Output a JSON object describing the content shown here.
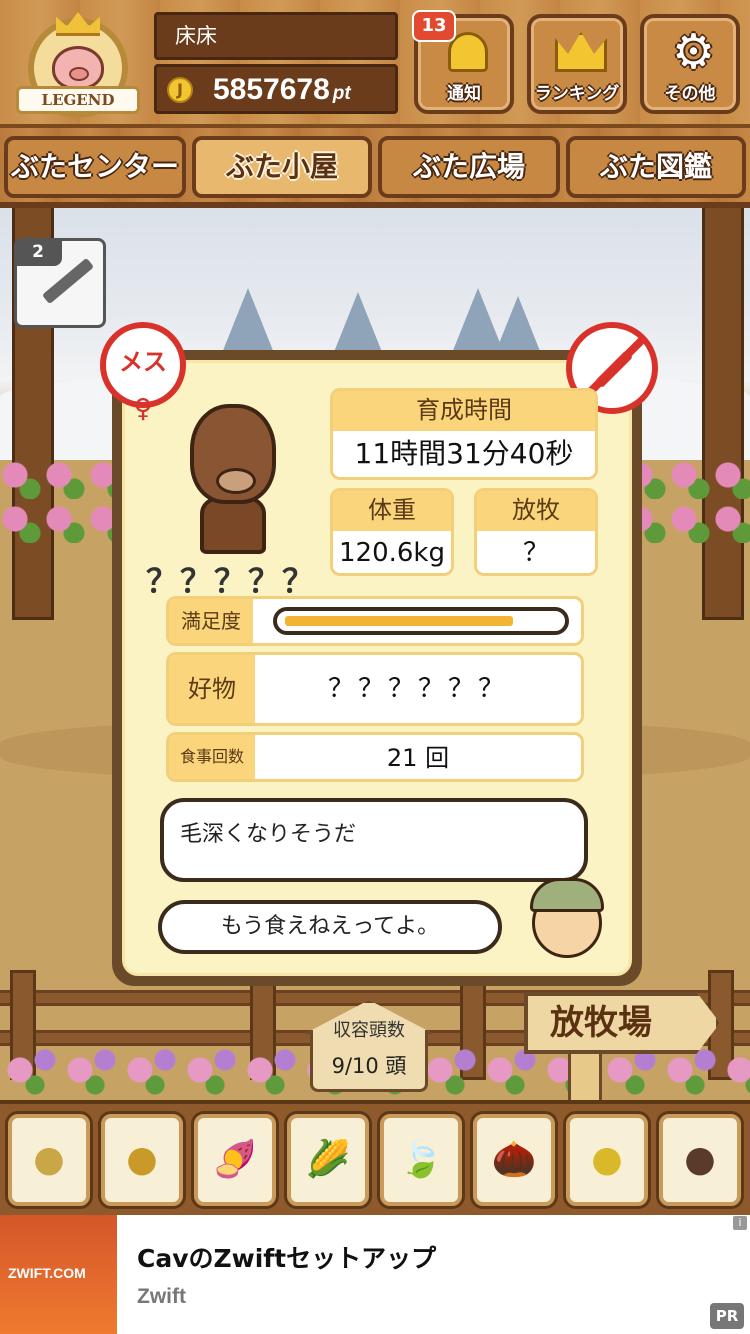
{
  "header": {
    "legend_label": "LEGEND",
    "player_name": "床床",
    "coin_symbol": "J",
    "points": "5857678",
    "points_unit": "pt",
    "notify": {
      "label": "通知",
      "badge_count": "13",
      "icon": "bell-icon"
    },
    "ranking": {
      "label": "ランキング",
      "icon": "crown-icon"
    },
    "other": {
      "label": "その他",
      "icon": "gear-icon"
    }
  },
  "tabs": [
    {
      "label": "ぶたセンター",
      "active": false
    },
    {
      "label": "ぶた小屋",
      "active": true
    },
    {
      "label": "ぶた広場",
      "active": false
    },
    {
      "label": "ぶた図鑑",
      "active": false
    }
  ],
  "item": {
    "count": "2",
    "icon": "syringe-icon"
  },
  "pig": {
    "gender_label": "メス",
    "gender_symbol": "♀",
    "name": "？？？？？",
    "raise_time_label": "育成時間",
    "raise_time": "11時間31分40秒",
    "weight_label": "体重",
    "weight": "120.6kg",
    "graze_label": "放牧",
    "graze": "？",
    "satisfaction_label": "満足度",
    "satisfaction_level": 0.84,
    "favorite_label": "好物",
    "favorite": "？？？？？？",
    "meals_label": "食事回数",
    "meals": "21 回",
    "message": "毛深くなりそうだ",
    "farmer_message": "もう食えねえってよ。"
  },
  "capacity": {
    "label": "収容頭数",
    "value": "9/10 頭"
  },
  "sign": {
    "label": "放牧場"
  },
  "feeds": [
    {
      "icon": "soybean-pile-icon",
      "glyph": "●"
    },
    {
      "icon": "grain-pile-icon",
      "glyph": "●"
    },
    {
      "icon": "sweet-potato-icon",
      "glyph": "🍠"
    },
    {
      "icon": "corn-icon",
      "glyph": "🌽"
    },
    {
      "icon": "leaf-nuts-icon",
      "glyph": "🍃"
    },
    {
      "icon": "acorn-icon",
      "glyph": "🌰"
    },
    {
      "icon": "grain-plate-icon",
      "glyph": "●"
    },
    {
      "icon": "dark-balls-plate-icon",
      "glyph": "●"
    }
  ],
  "ad": {
    "image_text": "ZWIFT.COM",
    "title": "CavのZwiftセットアップ",
    "advertiser": "Zwift",
    "info_icon": "i",
    "pr_label": "PR"
  },
  "colors": {
    "wood": "#c98d48",
    "panel_bg": "#fbf3c4",
    "label_yellow": "#fbd57b",
    "female_red": "#d8322a",
    "bar_fill": "#f2b531"
  }
}
